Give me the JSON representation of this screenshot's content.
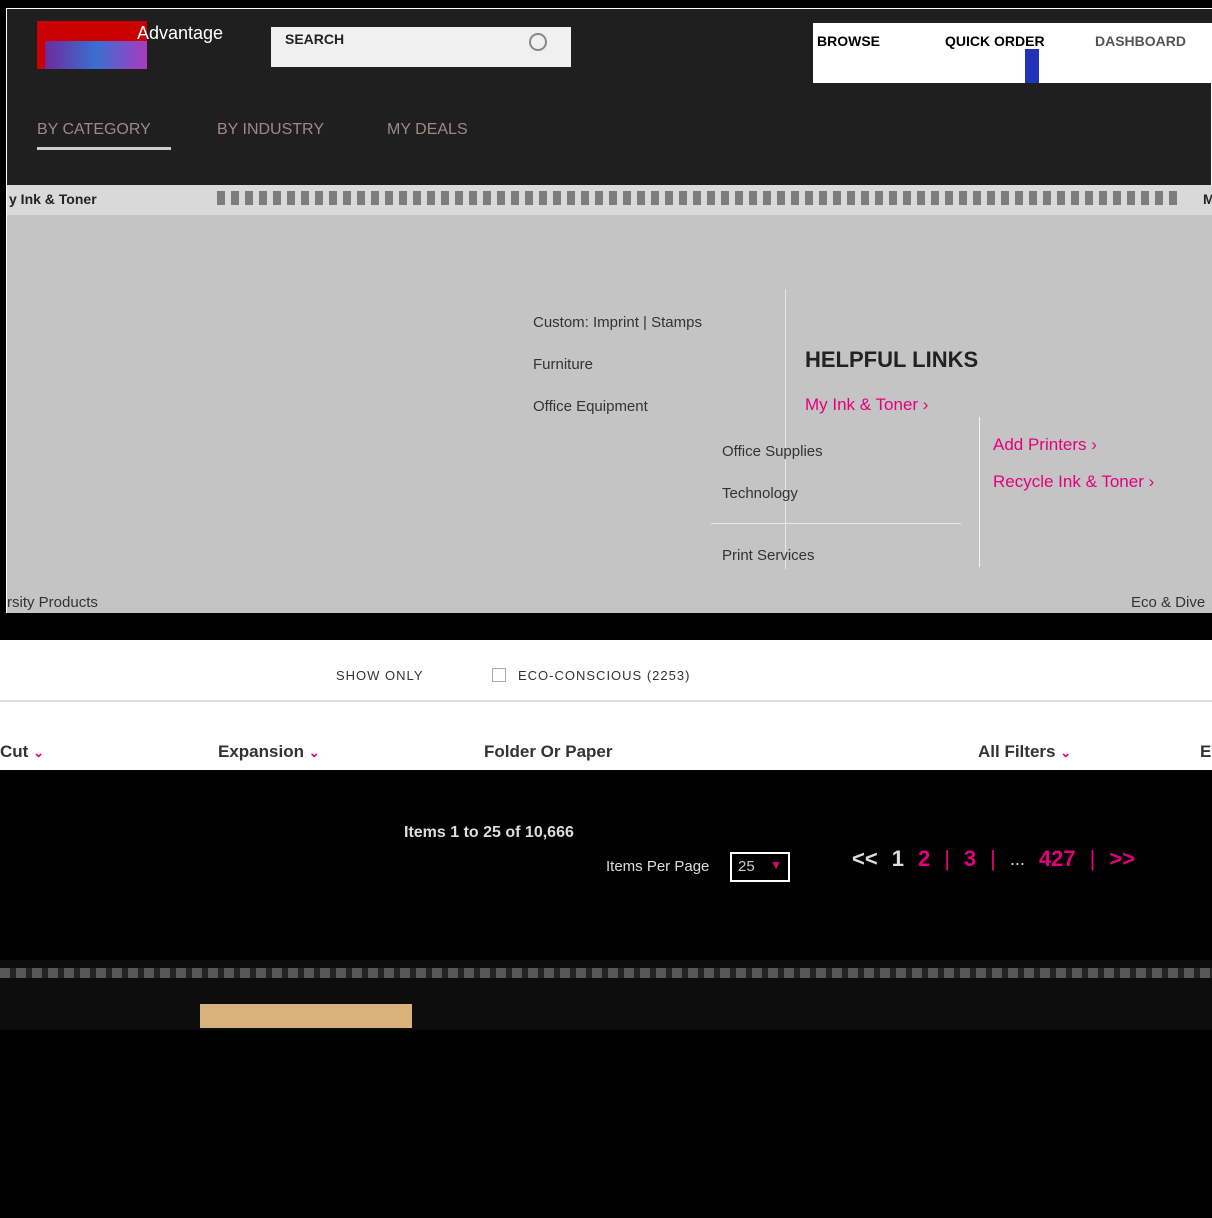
{
  "header": {
    "advantage": "Advantage",
    "search_label": "SEARCH",
    "nav": {
      "browse": "BROWSE",
      "quick_order": "QUICK ORDER",
      "dashboard": "DASHBOARD"
    },
    "tabs": {
      "by_category": "BY CATEGORY",
      "by_industry": "BY INDUSTRY",
      "my_deals": "MY DEALS"
    }
  },
  "menu": {
    "ink_tab": "y Ink & Toner",
    "right_char": "M",
    "categories": [
      "Custom: Imprint | Stamps",
      "Furniture",
      "Office Equipment"
    ],
    "sub_categories": [
      "Office Supplies",
      "Technology",
      "Print Services"
    ],
    "helpful_links": {
      "title": "HELPFUL LINKS",
      "links": [
        "My Ink & Toner ›",
        "Add Printers ›",
        "Recycle Ink & Toner ›"
      ]
    },
    "bottom_left": "rsity Products",
    "bottom_right": "Eco & Dive"
  },
  "filters": {
    "show_only": "SHOW ONLY",
    "eco_label": "ECO-CONSCIOUS (2253)",
    "items": [
      {
        "label": "Cut",
        "chevron": "⌄"
      },
      {
        "label": "Expansion",
        "chevron": "⌄"
      },
      {
        "label": "Folder Or Paper",
        "chevron": ""
      },
      {
        "label": "All Filters",
        "chevron": "⌄"
      },
      {
        "label": "E",
        "chevron": ""
      }
    ]
  },
  "results": {
    "items_count": "Items 1 to 25 of 10,666",
    "ipp_label": "Items Per Page",
    "ipp_value": "25",
    "pager": {
      "prev": "<<",
      "current": "1",
      "p2": "2",
      "p3": "3",
      "ellipsis": "...",
      "last": "427",
      "next": ">>"
    }
  },
  "colors": {
    "accent": "#e3007c",
    "panel": "#c4c4c4",
    "dark": "#1f1f1f"
  }
}
